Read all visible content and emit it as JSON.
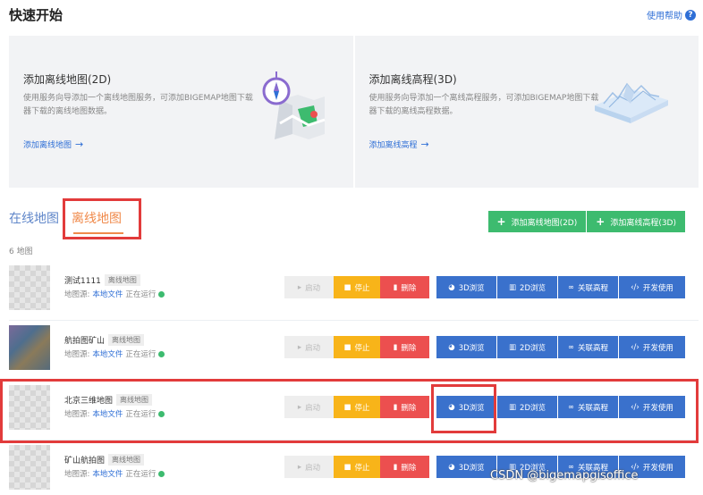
{
  "header": {
    "title": "快速开始",
    "help": "使用帮助",
    "help_icon": "?"
  },
  "cards": [
    {
      "title": "添加离线地图(2D)",
      "desc": "使用服务向导添加一个离线地图服务，可添加BIGEMAP地图下载器下载的离线地图数据。",
      "link": "添加离线地图"
    },
    {
      "title": "添加离线高程(3D)",
      "desc": "使用服务向导添加一个离线高程服务，可添加BIGEMAP地图下载器下载的离线高程数据。",
      "link": "添加离线高程"
    }
  ],
  "tabs": {
    "online": "在线地图",
    "offline": "离线地图"
  },
  "add_buttons": {
    "add_map": "添加离线地图(2D)",
    "add_elev": "添加离线高程(3D)"
  },
  "count": "6 地图",
  "row_labels": {
    "source_label": "地图源:",
    "source_value": "本地文件",
    "status": "正在运行",
    "start": "启动",
    "stop": "停止",
    "delete": "删除",
    "view3d": "3D浏览",
    "view2d": "2D浏览",
    "link_elev": "关联高程",
    "dev_use": "开发使用"
  },
  "rows": [
    {
      "name": "测试1111",
      "badge": "离线地图"
    },
    {
      "name": "航拍图矿山",
      "badge": "离线地图"
    },
    {
      "name": "北京三维地图",
      "badge": "离线地图"
    },
    {
      "name": "矿山航拍图",
      "badge": "离线地图"
    }
  ],
  "watermark": "CSDN @bigemapgisoffice",
  "colors": {
    "primary": "#3a71cc",
    "green": "#3dbb6f",
    "stop": "#f8b419",
    "delete": "#ec4f4f",
    "tab_active": "#f08a4b",
    "highlight": "#e23b3b"
  }
}
